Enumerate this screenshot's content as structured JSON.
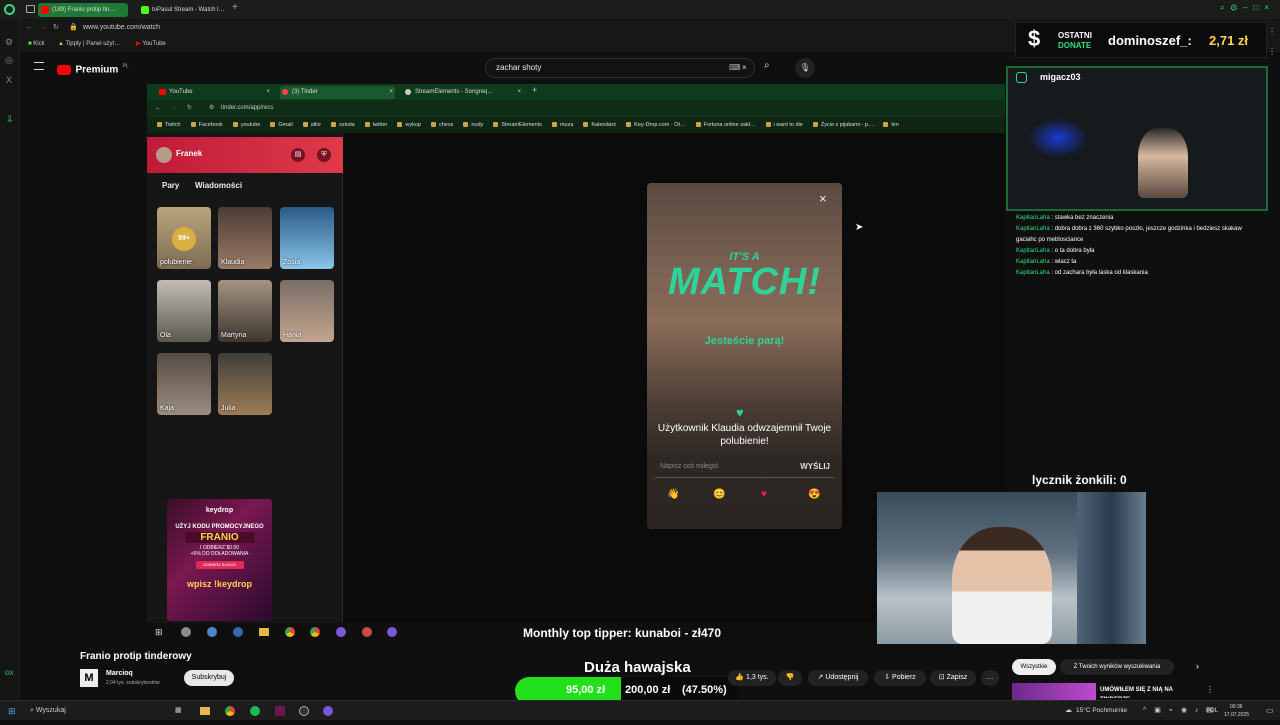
{
  "outer_browser": {
    "tabs": [
      {
        "label": "(189) Franio protip tin…",
        "active": true
      },
      {
        "label": "toPasut Stream - Watch l…",
        "active": false
      }
    ],
    "url": "www.youtube.com/watch",
    "bookmarks": [
      "Kick",
      "Tipply | Panel użyt…",
      "YouTube"
    ]
  },
  "youtube": {
    "logo": "Premium",
    "logo_sup": "PL",
    "search_value": "zachar shoty",
    "video_title": "Franio protip tinderowy",
    "channel_name": "Marcioq",
    "subscribers": "2,04 tys. subskrybentów",
    "subscribe_label": "Subskrybuj",
    "likes": "1,3 tys.",
    "share_label": "Udostępnij",
    "download_label": "Pobierz",
    "save_label": "Zapisz",
    "filter_all": "Wszystkie",
    "filter_results": "Z Twoich wyników wyszukiwania",
    "suggested_title": "UMÓWIŁEM SIĘ Z NIĄ NA TINDERZE"
  },
  "inner_browser": {
    "tabs": [
      "YouTube",
      "(3) Tinder",
      "StreamElements - Songreq…"
    ],
    "url": "tinder.com/app/recs",
    "bookmarks": [
      "Twitch",
      "Facebook",
      "youtube",
      "Gmail",
      "allor",
      "szkoła",
      "twitter",
      "wykop",
      "chess",
      "nudy",
      "StreamElements",
      "muza",
      "Kalendarz",
      "Key-Drop.com - Ot…",
      "Fortuna online zakł…",
      "i want to die",
      "Życie z pijakami - p…",
      "km"
    ]
  },
  "tinder": {
    "user_name": "Franek",
    "tab_pairs": "Pary",
    "tab_messages": "Wiadomości",
    "likes_badge": "99+",
    "likes_label": "polubienie",
    "matches": [
      "Klaudia",
      "Zosia",
      "Ola",
      "Martyna",
      "Hania",
      "Kaja",
      "Julia"
    ],
    "match_popup": {
      "subtitle_top": "IT'S A",
      "title": "MATCH!",
      "subtitle": "Jesteście parą!",
      "message": "Użytkownik Klaudia odwzajemnił Twoje polubienie!",
      "input_placeholder": "Napisz coś miłego!",
      "send_label": "WYŚLIJ"
    },
    "ad": {
      "brand": "keydrop",
      "line1": "UŻYJ KODU PROMOCYJNEGO",
      "code": "FRANIO",
      "line2": "I ODBIERZ $0.50",
      "line3": "+5% DO DOŁADOWANIA",
      "button": "ODBIERZ BONUS",
      "footer": "wpisz !keydrop"
    }
  },
  "overlay": {
    "donate_label_1": "OSTATNI",
    "donate_label_2": "DONATE",
    "donor": "dominoszef_:",
    "donate_amount": "2,71 zł",
    "instagram": "migacz03",
    "chat": [
      {
        "user": "KapitanLaha",
        "text": "stawka bez znaczenia"
      },
      {
        "user": "KapitanLaha",
        "text": "dobra dobra z 360 szybko poszło, jeszcze godzinka i bedziesz skakaw gaciahc po meblosciance"
      },
      {
        "user": "KapitanLaha",
        "text": "o ta dobra była"
      },
      {
        "user": "KapitanLaha",
        "text": "wlacz ta"
      },
      {
        "user": "KapitanLaha",
        "text": "od zachara była laska od klaskania"
      }
    ],
    "counter": "lycznik żonkili: 0",
    "top_tipper": "Monthly top tipper: kunaboi - zł470",
    "goal_title": "Duża hawajska",
    "goal_current": "95,00 zł",
    "goal_target": "200,00 zł",
    "goal_percent": "(47.50%)",
    "goal_fraction": 0.475
  },
  "taskbar": {
    "search": "Wyszukaj",
    "weather": "15°C Pochmurnie",
    "lang": "POL",
    "time": "00:36",
    "date": "17.07.2025"
  },
  "colors": {
    "accent_green": "#2fd39a",
    "progress_green": "#22e01a",
    "tinder_red": "#d0283f",
    "youtube_red": "#ff0000"
  }
}
